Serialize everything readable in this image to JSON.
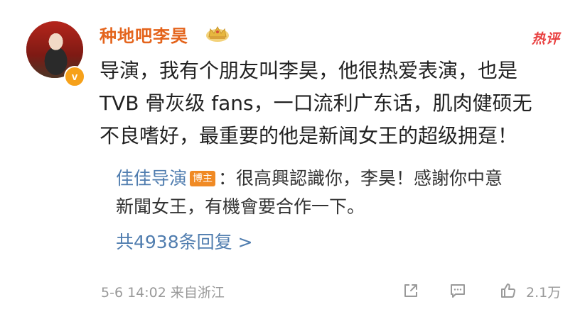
{
  "comment": {
    "username": "种地吧李昊",
    "hot_label": "热评",
    "verified_label": "v",
    "text_lines": [
      "导演，我有个朋友叫李昊，他很热爱表演，也是",
      "TVB 骨灰级 fans，一口流利广东话，肌肉健硕无",
      "不良嗜好，最重要的他是新闻女王的超级拥趸！"
    ],
    "time": "5-6 14:02",
    "location": "来自浙江",
    "likes": "2.1万"
  },
  "reply": {
    "author": "佳佳导演",
    "author_tag": "博主",
    "text_line1": "：很高興認識你，李昊！感謝你中意",
    "text_line2": "新聞女王，有機會要合作一下。"
  },
  "replies": {
    "count_label": "共4938条回复 >"
  },
  "icons": {
    "avatar": "user-avatar",
    "verified": "verified-badge-icon",
    "crown": "crown-icon",
    "share": "share-icon",
    "comment": "comment-icon",
    "like": "thumbs-up-icon"
  },
  "colors": {
    "username": "#e4641c",
    "hot": "#e94141",
    "link": "#507daf",
    "meta": "#999999"
  }
}
